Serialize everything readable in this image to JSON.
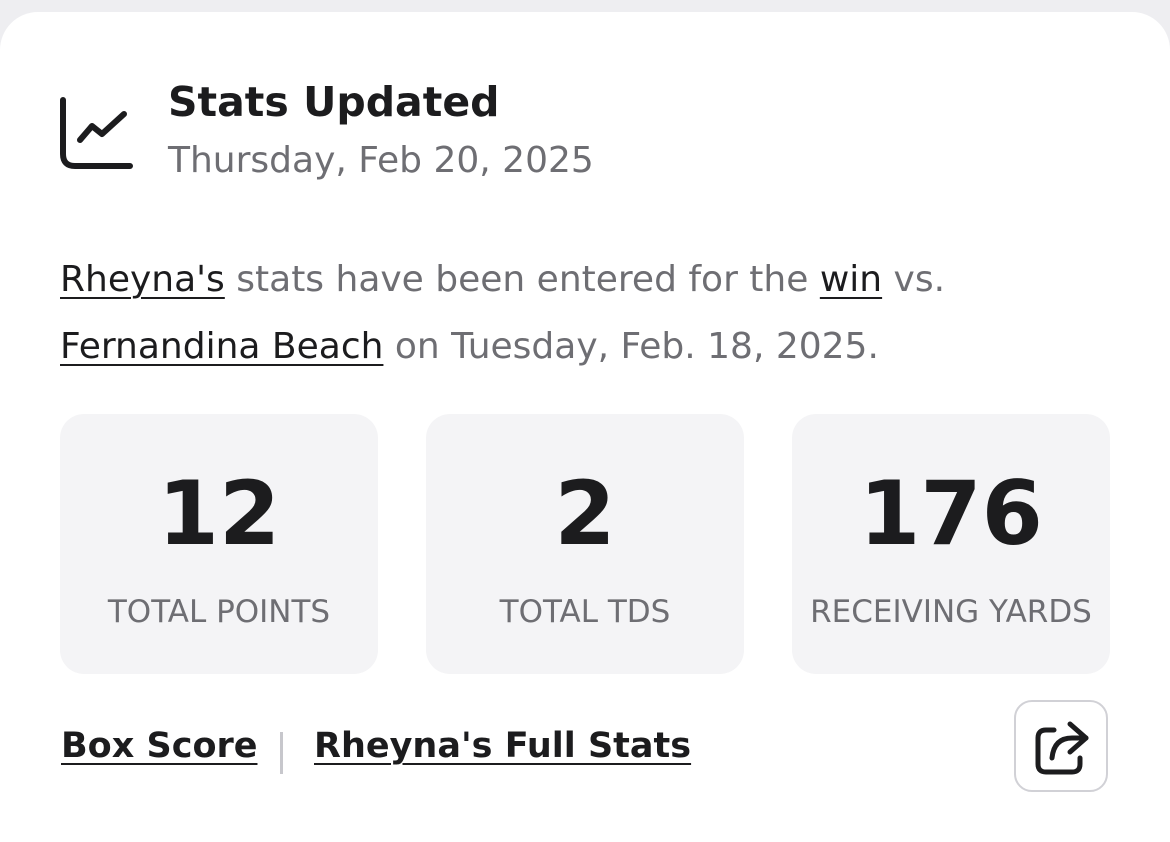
{
  "header": {
    "icon": "line-chart-icon",
    "title": "Stats Updated",
    "date": "Thursday, Feb 20, 2025"
  },
  "summary": {
    "player_link": "Rheyna's",
    "text_1": " stats have been entered for the ",
    "result_link": "win",
    "text_2": " vs. ",
    "opponent_link": "Fernandina Beach",
    "text_3": " on Tuesday, Feb. 18, 2025."
  },
  "stats": [
    {
      "value": "12",
      "label": "TOTAL POINTS"
    },
    {
      "value": "2",
      "label": "TOTAL TDS"
    },
    {
      "value": "176",
      "label": "RECEIVING YARDS"
    }
  ],
  "footer": {
    "box_score_label": "Box Score",
    "full_stats_label": "Rheyna's Full Stats",
    "share_icon": "share-icon"
  },
  "colors": {
    "text_primary": "#1c1c1e",
    "text_secondary": "#6e6e73",
    "stat_box_bg": "#f4f4f6"
  }
}
